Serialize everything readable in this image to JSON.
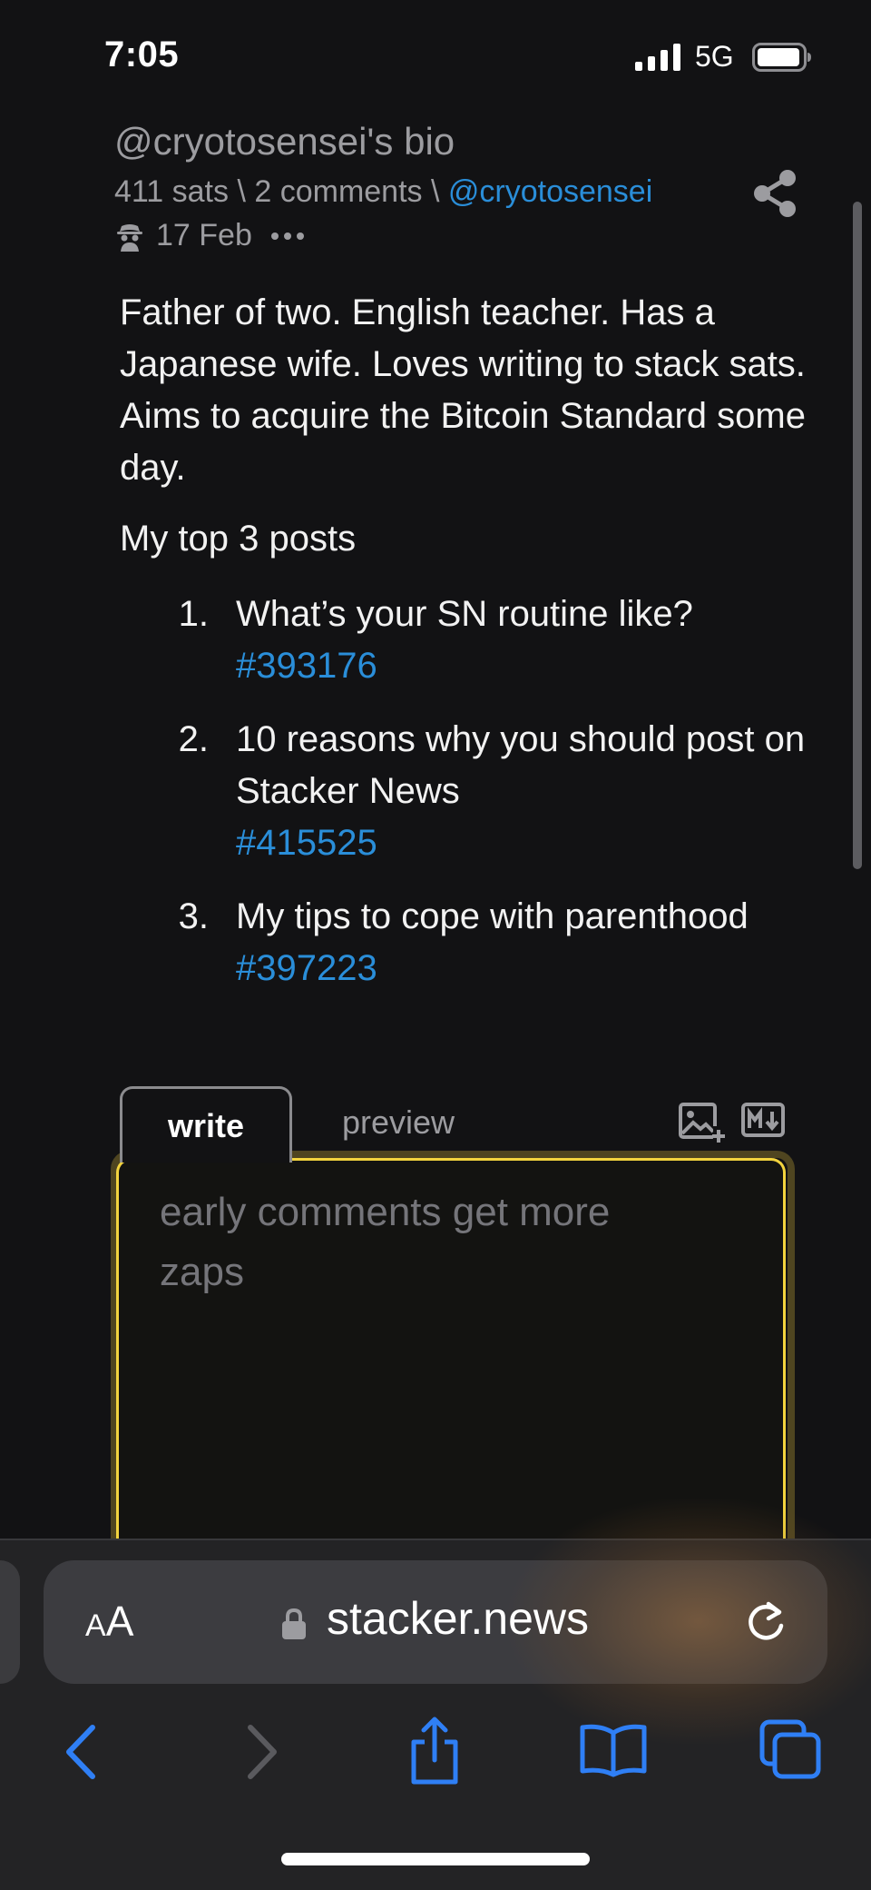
{
  "status_bar": {
    "time": "7:05",
    "network": "5G"
  },
  "post": {
    "title": "@cryotosensei's bio",
    "sats": "411 sats",
    "separator": " \\ ",
    "comments": "2 comments",
    "author": "@cryotosensei",
    "date": "17 Feb",
    "bio": "Father of two. English teacher. Has a Japanese wife. Loves writing to stack sats. Aims to acquire the Bitcoin Standard some day.",
    "top_posts_title": "My top 3 posts",
    "top_posts": [
      {
        "num": "1.",
        "title": "What’s your SN routine like?",
        "ref": "#393176"
      },
      {
        "num": "2.",
        "title": "10 reasons why you should post on Stacker News",
        "ref": "#415525"
      },
      {
        "num": "3.",
        "title": "My tips to cope with parenthood",
        "ref": "#397223"
      }
    ]
  },
  "editor": {
    "tab_write": "write",
    "tab_preview": "preview",
    "placeholder": "early comments get more zaps"
  },
  "browser": {
    "text_size_label_big": "A",
    "text_size_label_small": "A",
    "url": "stacker.news"
  },
  "colors": {
    "link": "#2a8ed9",
    "editor_border": "#f2d33e",
    "browser_blue": "#2f7ff5"
  }
}
